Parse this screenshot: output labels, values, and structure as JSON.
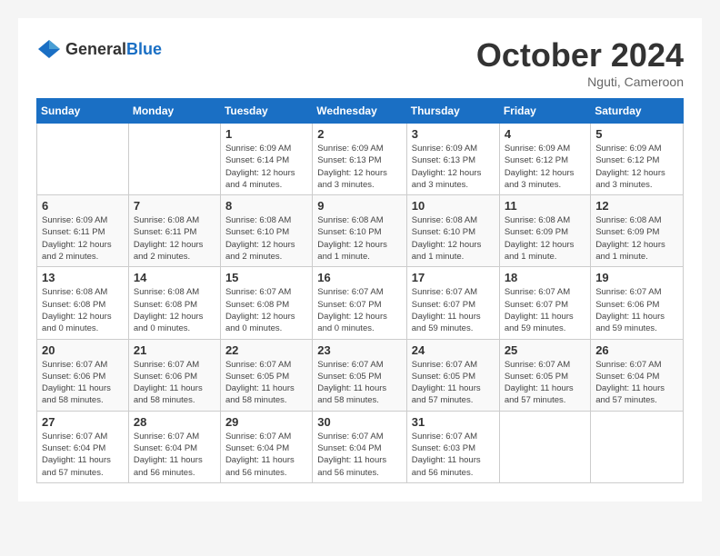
{
  "header": {
    "logo_general": "General",
    "logo_blue": "Blue",
    "month_title": "October 2024",
    "location": "Nguti, Cameroon"
  },
  "days_of_week": [
    "Sunday",
    "Monday",
    "Tuesday",
    "Wednesday",
    "Thursday",
    "Friday",
    "Saturday"
  ],
  "weeks": [
    [
      {
        "day": "",
        "info": ""
      },
      {
        "day": "",
        "info": ""
      },
      {
        "day": "1",
        "info": "Sunrise: 6:09 AM\nSunset: 6:14 PM\nDaylight: 12 hours and 4 minutes."
      },
      {
        "day": "2",
        "info": "Sunrise: 6:09 AM\nSunset: 6:13 PM\nDaylight: 12 hours and 3 minutes."
      },
      {
        "day": "3",
        "info": "Sunrise: 6:09 AM\nSunset: 6:13 PM\nDaylight: 12 hours and 3 minutes."
      },
      {
        "day": "4",
        "info": "Sunrise: 6:09 AM\nSunset: 6:12 PM\nDaylight: 12 hours and 3 minutes."
      },
      {
        "day": "5",
        "info": "Sunrise: 6:09 AM\nSunset: 6:12 PM\nDaylight: 12 hours and 3 minutes."
      }
    ],
    [
      {
        "day": "6",
        "info": "Sunrise: 6:09 AM\nSunset: 6:11 PM\nDaylight: 12 hours and 2 minutes."
      },
      {
        "day": "7",
        "info": "Sunrise: 6:08 AM\nSunset: 6:11 PM\nDaylight: 12 hours and 2 minutes."
      },
      {
        "day": "8",
        "info": "Sunrise: 6:08 AM\nSunset: 6:10 PM\nDaylight: 12 hours and 2 minutes."
      },
      {
        "day": "9",
        "info": "Sunrise: 6:08 AM\nSunset: 6:10 PM\nDaylight: 12 hours and 1 minute."
      },
      {
        "day": "10",
        "info": "Sunrise: 6:08 AM\nSunset: 6:10 PM\nDaylight: 12 hours and 1 minute."
      },
      {
        "day": "11",
        "info": "Sunrise: 6:08 AM\nSunset: 6:09 PM\nDaylight: 12 hours and 1 minute."
      },
      {
        "day": "12",
        "info": "Sunrise: 6:08 AM\nSunset: 6:09 PM\nDaylight: 12 hours and 1 minute."
      }
    ],
    [
      {
        "day": "13",
        "info": "Sunrise: 6:08 AM\nSunset: 6:08 PM\nDaylight: 12 hours and 0 minutes."
      },
      {
        "day": "14",
        "info": "Sunrise: 6:08 AM\nSunset: 6:08 PM\nDaylight: 12 hours and 0 minutes."
      },
      {
        "day": "15",
        "info": "Sunrise: 6:07 AM\nSunset: 6:08 PM\nDaylight: 12 hours and 0 minutes."
      },
      {
        "day": "16",
        "info": "Sunrise: 6:07 AM\nSunset: 6:07 PM\nDaylight: 12 hours and 0 minutes."
      },
      {
        "day": "17",
        "info": "Sunrise: 6:07 AM\nSunset: 6:07 PM\nDaylight: 11 hours and 59 minutes."
      },
      {
        "day": "18",
        "info": "Sunrise: 6:07 AM\nSunset: 6:07 PM\nDaylight: 11 hours and 59 minutes."
      },
      {
        "day": "19",
        "info": "Sunrise: 6:07 AM\nSunset: 6:06 PM\nDaylight: 11 hours and 59 minutes."
      }
    ],
    [
      {
        "day": "20",
        "info": "Sunrise: 6:07 AM\nSunset: 6:06 PM\nDaylight: 11 hours and 58 minutes."
      },
      {
        "day": "21",
        "info": "Sunrise: 6:07 AM\nSunset: 6:06 PM\nDaylight: 11 hours and 58 minutes."
      },
      {
        "day": "22",
        "info": "Sunrise: 6:07 AM\nSunset: 6:05 PM\nDaylight: 11 hours and 58 minutes."
      },
      {
        "day": "23",
        "info": "Sunrise: 6:07 AM\nSunset: 6:05 PM\nDaylight: 11 hours and 58 minutes."
      },
      {
        "day": "24",
        "info": "Sunrise: 6:07 AM\nSunset: 6:05 PM\nDaylight: 11 hours and 57 minutes."
      },
      {
        "day": "25",
        "info": "Sunrise: 6:07 AM\nSunset: 6:05 PM\nDaylight: 11 hours and 57 minutes."
      },
      {
        "day": "26",
        "info": "Sunrise: 6:07 AM\nSunset: 6:04 PM\nDaylight: 11 hours and 57 minutes."
      }
    ],
    [
      {
        "day": "27",
        "info": "Sunrise: 6:07 AM\nSunset: 6:04 PM\nDaylight: 11 hours and 57 minutes."
      },
      {
        "day": "28",
        "info": "Sunrise: 6:07 AM\nSunset: 6:04 PM\nDaylight: 11 hours and 56 minutes."
      },
      {
        "day": "29",
        "info": "Sunrise: 6:07 AM\nSunset: 6:04 PM\nDaylight: 11 hours and 56 minutes."
      },
      {
        "day": "30",
        "info": "Sunrise: 6:07 AM\nSunset: 6:04 PM\nDaylight: 11 hours and 56 minutes."
      },
      {
        "day": "31",
        "info": "Sunrise: 6:07 AM\nSunset: 6:03 PM\nDaylight: 11 hours and 56 minutes."
      },
      {
        "day": "",
        "info": ""
      },
      {
        "day": "",
        "info": ""
      }
    ]
  ]
}
